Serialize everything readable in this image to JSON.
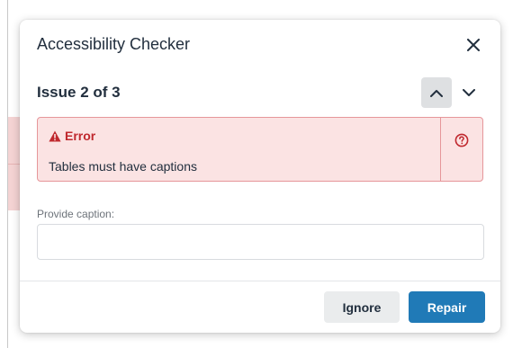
{
  "dialog": {
    "title": "Accessibility Checker",
    "close_icon": "close-icon"
  },
  "issue": {
    "title": "Issue 2 of 3",
    "prev_icon": "chevron-up-icon",
    "next_icon": "chevron-down-icon"
  },
  "error": {
    "severity_label": "Error",
    "severity_icon": "warning-icon",
    "message": "Tables must have captions",
    "help_icon": "help-icon"
  },
  "caption_field": {
    "label": "Provide caption:",
    "value": "",
    "placeholder": ""
  },
  "footer": {
    "ignore_label": "Ignore",
    "repair_label": "Repair"
  },
  "colors": {
    "error_text": "#c0282e",
    "error_bg": "#fbe3e3",
    "primary": "#207ab7"
  }
}
